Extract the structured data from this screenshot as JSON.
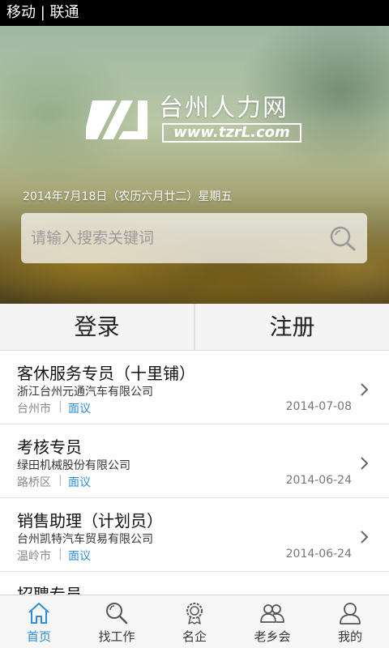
{
  "status_bar": {
    "carrier": "移动 | 联通"
  },
  "hero": {
    "logo_title": "台州人力网",
    "logo_url": "www.tzrL.com",
    "date": "2014年7月18日（农历六月廿二）星期五",
    "search": {
      "placeholder": "请输入搜索关键词",
      "value": ""
    }
  },
  "auth": {
    "login_label": "登录",
    "register_label": "注册"
  },
  "jobs": [
    {
      "title": "客休服务专员（十里铺）",
      "company": "浙江台州元通汽车有限公司",
      "location": "台州市",
      "separator": "|",
      "salary": "面议",
      "date": "2014-07-08"
    },
    {
      "title": "考核专员",
      "company": "绿田机械股份有限公司",
      "location": "路桥区",
      "separator": "|",
      "salary": "面议",
      "date": "2014-06-24"
    },
    {
      "title": "销售助理（计划员）",
      "company": "台州凯特汽车贸易有限公司",
      "location": "温岭市",
      "separator": "|",
      "salary": "面议",
      "date": "2014-06-24"
    },
    {
      "title": "招聘专员",
      "company": "",
      "location": "",
      "separator": "",
      "salary": "",
      "date": ""
    }
  ],
  "tabbar": {
    "active": "home",
    "items": [
      {
        "label": "首页",
        "icon": "home-icon"
      },
      {
        "label": "找工作",
        "icon": "search-icon"
      },
      {
        "label": "名企",
        "icon": "badge-icon"
      },
      {
        "label": "老乡会",
        "icon": "people-icon"
      },
      {
        "label": "我的",
        "icon": "user-icon"
      }
    ]
  },
  "colors": {
    "accent": "#2a8fd6",
    "status_bar": "#000000"
  }
}
